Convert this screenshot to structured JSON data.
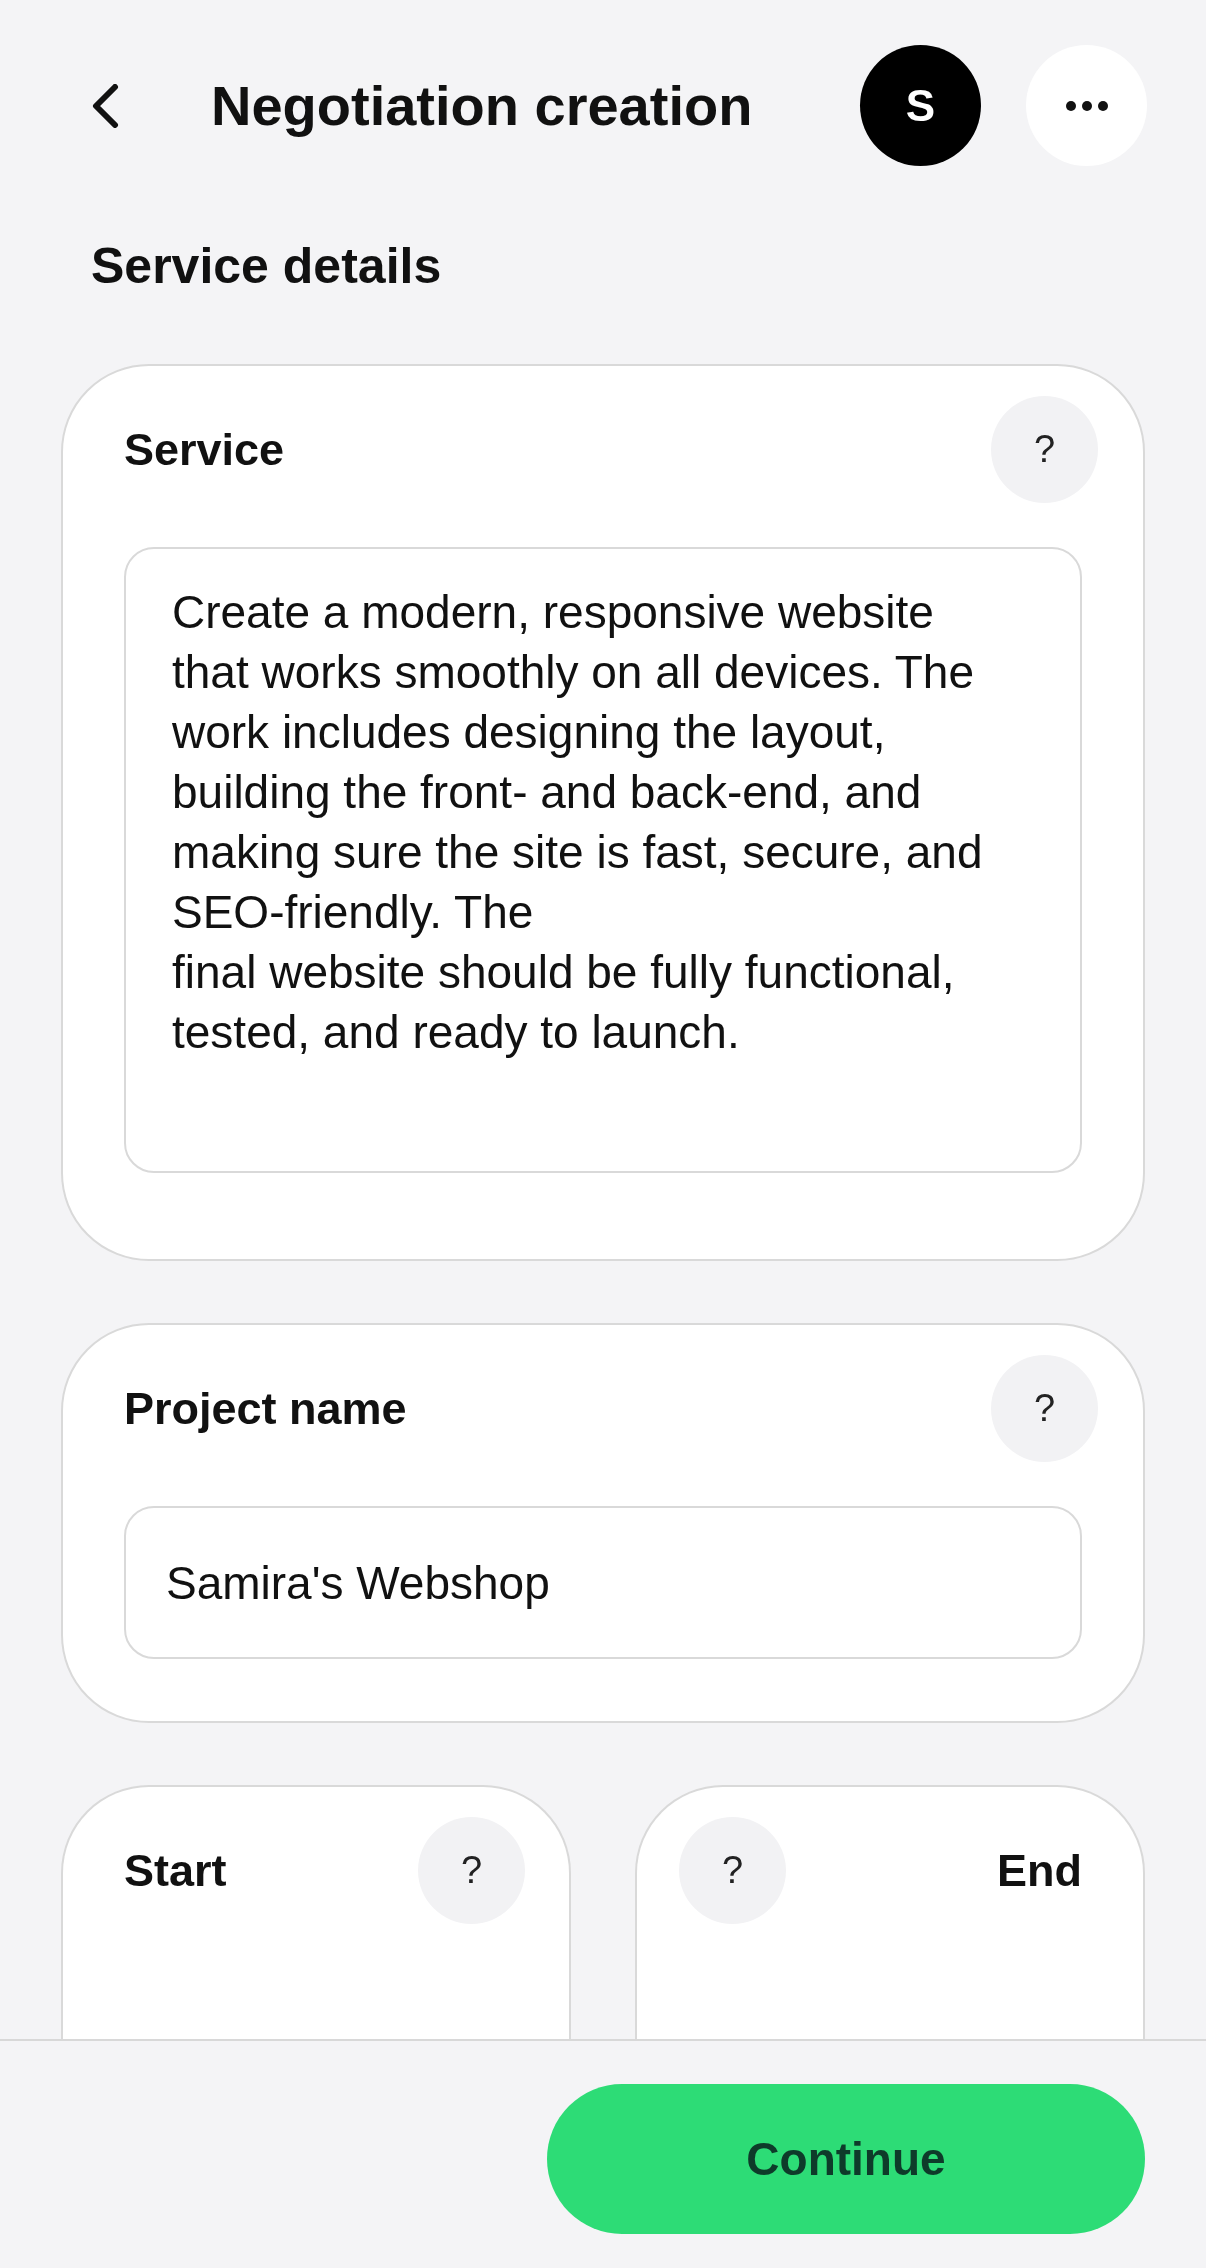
{
  "header": {
    "title": "Negotiation creation",
    "avatar_initial": "S"
  },
  "section_title": "Service details",
  "fields": [
    {
      "kind": "textarea",
      "label": "Service",
      "help": "?",
      "value": "Create a modern, responsive website that works smoothly on all devices. The work includes designing the layout, building the front- and back-end, and making sure the site is fast, secure, and SEO-friendly. The\nfinal website should be fully functional, tested, and ready to launch."
    },
    {
      "kind": "input",
      "label": "Project name",
      "help": "?",
      "value": "Samira's Webshop"
    }
  ],
  "date_fields": [
    {
      "kind": "plain",
      "label": "Start",
      "help": "?"
    },
    {
      "kind": "mirrored",
      "label": "End",
      "help": "?"
    }
  ],
  "footer": {
    "primary_button": "Continue"
  }
}
